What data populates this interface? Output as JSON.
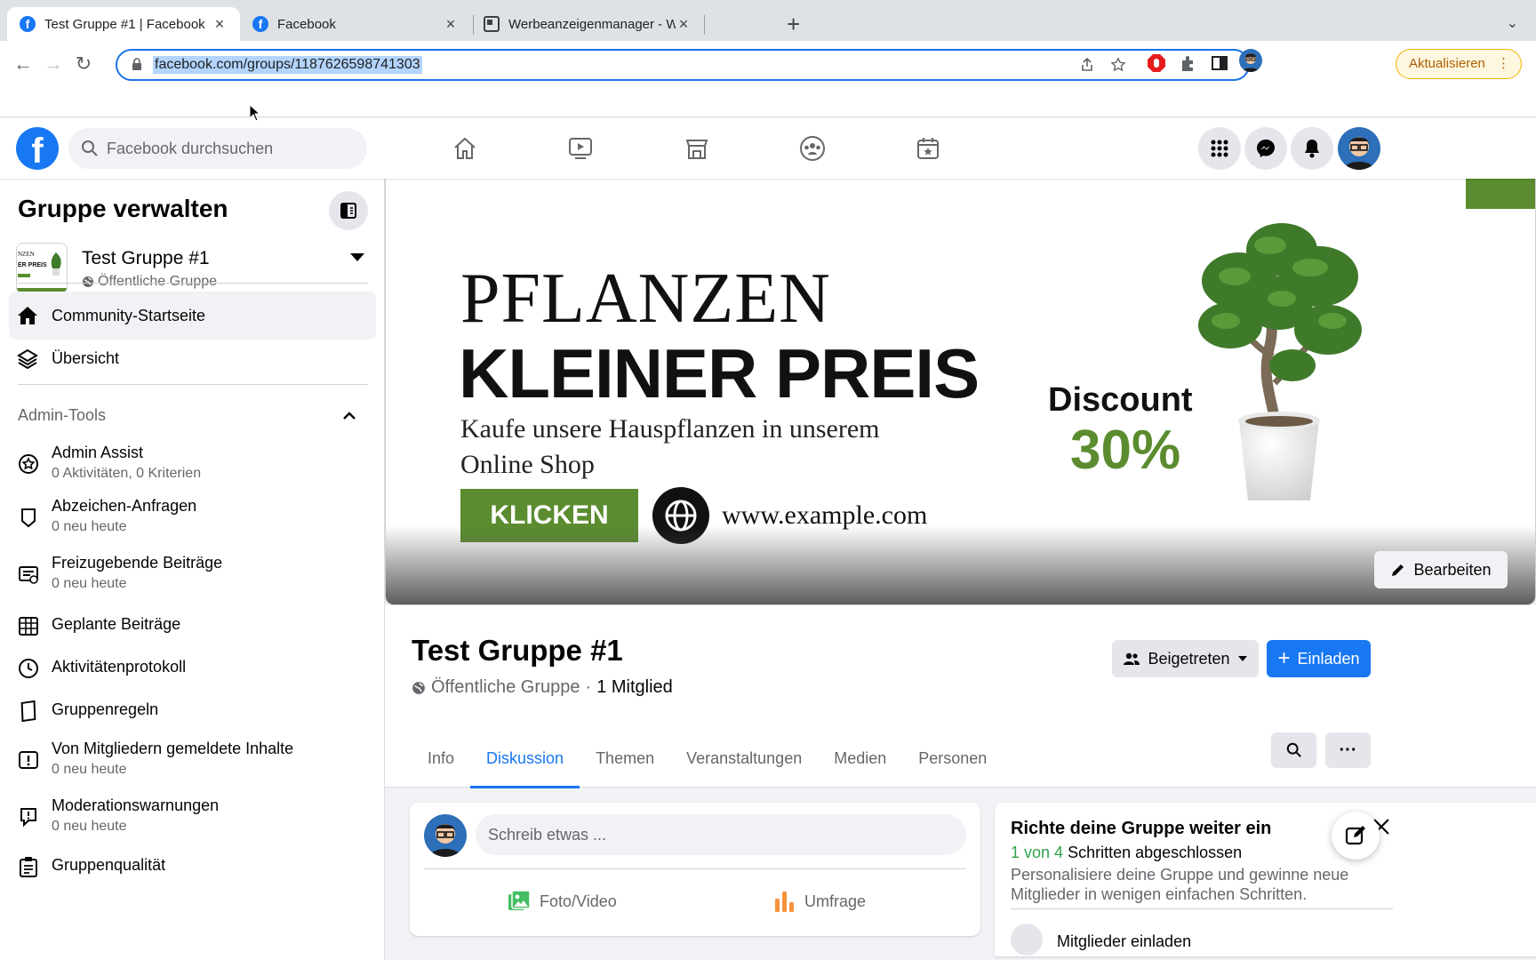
{
  "browser": {
    "tabs": [
      {
        "title": "Test Gruppe #1 | Facebook",
        "active": true,
        "favicon": "facebook-icon"
      },
      {
        "title": "Facebook",
        "active": false,
        "favicon": "facebook-icon"
      },
      {
        "title": "Werbeanzeigenmanager - Werb",
        "active": false,
        "favicon": "ads-manager-icon"
      }
    ],
    "url": "facebook.com/groups/1187626598741303",
    "update_label": "Aktualisieren"
  },
  "fb": {
    "search_placeholder": "Facebook durchsuchen",
    "nav": [
      "home-icon",
      "watch-icon",
      "marketplace-icon",
      "groups-icon",
      "gaming-icon"
    ],
    "right": [
      "menu-grid-icon",
      "messenger-icon",
      "notifications-icon",
      "profile-avatar"
    ]
  },
  "sidebar": {
    "title": "Gruppe verwalten",
    "group_name": "Test Gruppe #1",
    "group_privacy": "Öffentliche Gruppe",
    "nav": [
      {
        "label": "Community-Startseite",
        "icon": "home-icon",
        "active": true
      },
      {
        "label": "Übersicht",
        "icon": "layers-icon",
        "active": false
      }
    ],
    "admin_tools_label": "Admin-Tools",
    "tools": [
      {
        "label": "Admin Assist",
        "sub": "0 Aktivitäten, 0 Kriterien",
        "icon": "admin-assist-icon"
      },
      {
        "label": "Abzeichen-Anfragen",
        "sub": "0 neu heute",
        "icon": "badge-icon"
      },
      {
        "label": "Freizugebende Beiträge",
        "sub": "0 neu heute",
        "icon": "pending-posts-icon"
      },
      {
        "label": "Geplante Beiträge",
        "sub": "",
        "icon": "calendar-icon"
      },
      {
        "label": "Aktivitätenprotokoll",
        "sub": "",
        "icon": "clock-icon"
      },
      {
        "label": "Gruppenregeln",
        "sub": "",
        "icon": "rules-icon"
      },
      {
        "label": "Von Mitgliedern gemeldete Inhalte",
        "sub": "0 neu heute",
        "icon": "report-icon"
      },
      {
        "label": "Moderationswarnungen",
        "sub": "0 neu heute",
        "icon": "warning-icon"
      },
      {
        "label": "Gruppenqualität",
        "sub": "",
        "icon": "quality-icon"
      }
    ]
  },
  "cover": {
    "line1": "PFLANZEN",
    "line2": "KLEINER PREIS",
    "line3": "Kaufe unsere Hauspflanzen in unserem Online Shop",
    "cta": "KLICKEN",
    "url": "www.example.com",
    "discount_label": "Discount",
    "discount_value": "30%",
    "edit_label": "Bearbeiten",
    "brand_green": "#5b8c2f"
  },
  "group": {
    "name": "Test Gruppe #1",
    "privacy": "Öffentliche Gruppe",
    "separator": "·",
    "members": "1 Mitglied",
    "joined_label": "Beigetreten",
    "invite_label": "Einladen",
    "tabs": [
      {
        "label": "Info",
        "active": false
      },
      {
        "label": "Diskussion",
        "active": true
      },
      {
        "label": "Themen",
        "active": false
      },
      {
        "label": "Veranstaltungen",
        "active": false
      },
      {
        "label": "Medien",
        "active": false
      },
      {
        "label": "Personen",
        "active": false
      }
    ]
  },
  "composer": {
    "placeholder": "Schreib etwas ...",
    "photo_label": "Foto/Video",
    "poll_label": "Umfrage"
  },
  "setup_card": {
    "title": "Richte deine Gruppe weiter ein",
    "progress_green": "1 von 4",
    "progress_rest": "Schritten abgeschlossen",
    "description": "Personalisiere deine Gruppe und gewinne neue Mitglieder in wenigen einfachen Schritten.",
    "next_item": "Mitglieder einladen"
  },
  "colors": {
    "fb_blue": "#1877f2",
    "text_secondary": "#65676b",
    "success_green": "#31a24c"
  }
}
